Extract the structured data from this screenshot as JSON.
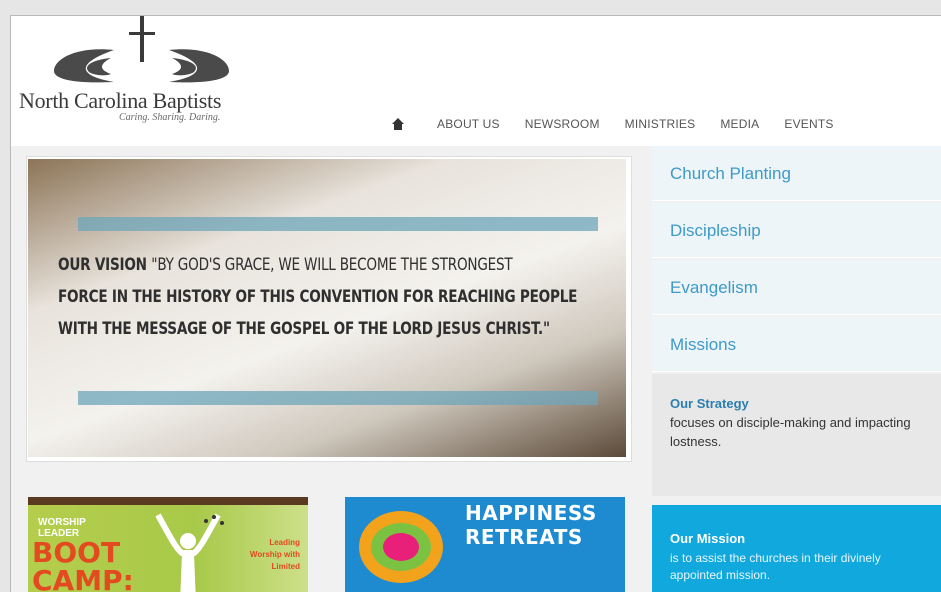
{
  "brand": {
    "name": "North Carolina Baptists",
    "tagline": "Caring. Sharing. Daring."
  },
  "nav": {
    "items": [
      "ABOUT US",
      "NEWSROOM",
      "MINISTRIES",
      "MEDIA",
      "EVENTS"
    ]
  },
  "hero": {
    "vision_label": "OUR VISION",
    "vision_lines": [
      "\"BY GOD'S GRACE, WE WILL BECOME THE STRONGEST",
      "FORCE IN THE HISTORY OF THIS CONVENTION FOR REACHING PEOPLE",
      "WITH THE MESSAGE OF THE GOSPEL OF THE LORD JESUS CHRIST.\""
    ]
  },
  "sidebar": {
    "items": [
      "Church Planting",
      "Discipleship",
      "Evangelism",
      "Missions"
    ],
    "strategy": {
      "title": "Our Strategy",
      "text": "focuses on disciple-making and impacting lostness."
    },
    "mission": {
      "title": "Our Mission",
      "text": "is to assist the churches in their divinely appointed mission."
    }
  },
  "tiles": {
    "bootcamp": {
      "small": "WORSHIP LEADER",
      "big": "BOOT CAMP:",
      "side": "Leading Worship with Limited"
    },
    "retreats": {
      "line1": "HAPPINESS",
      "line2": "RETREATS"
    }
  },
  "colors": {
    "accent": "#3e9ac7",
    "mission_bg": "#11a8dd"
  }
}
